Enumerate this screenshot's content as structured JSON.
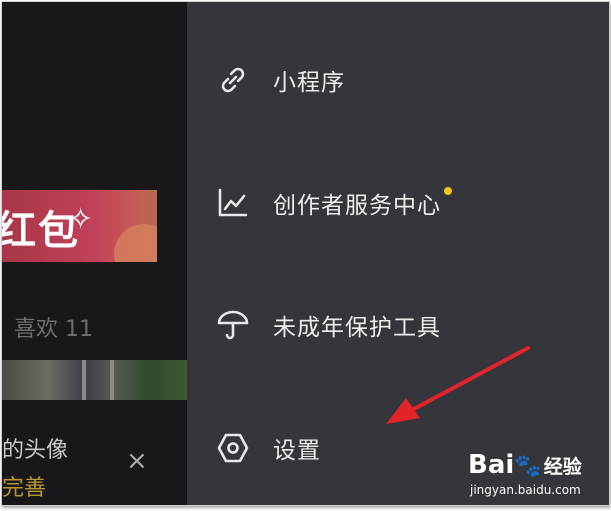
{
  "background": {
    "banner_text": "红包",
    "banner_spark": "✧",
    "likes_label": "喜欢 11",
    "avatar_prompt": "的头像",
    "complete_link": "完善",
    "close_glyph": "×"
  },
  "menu": {
    "items": [
      {
        "label": "小程序",
        "icon": "link-icon"
      },
      {
        "label": "创作者服务中心",
        "icon": "chart-icon",
        "has_dot": true
      },
      {
        "label": "未成年保护工具",
        "icon": "umbrella-icon"
      },
      {
        "label": "设置",
        "icon": "hexagon-settings-icon"
      }
    ]
  },
  "watermark": {
    "logo_text": "Bai",
    "logo_suffix": "经验",
    "url": "jingyan.baidu.com"
  },
  "colors": {
    "drawer_bg": "#35363b",
    "notification_dot": "#f5c518",
    "annotation_arrow": "#e0242a"
  }
}
